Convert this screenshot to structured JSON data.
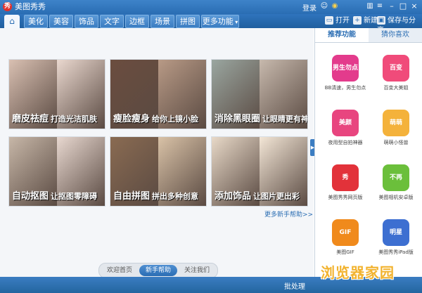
{
  "app": {
    "title": "美图秀秀",
    "login": "登录"
  },
  "tabs": [
    "美化",
    "美容",
    "饰品",
    "文字",
    "边框",
    "场景",
    "拼图",
    "更多功能"
  ],
  "actions": {
    "open": "打开",
    "new": "新建",
    "save_share": "保存与分享"
  },
  "features": [
    {
      "title": "磨皮祛痘",
      "subtitle": "打造光洁肌肤",
      "colors": [
        "#d9c0b2",
        "#ead8cf"
      ]
    },
    {
      "title": "瘦脸瘦身",
      "subtitle": "给你上镜小脸",
      "colors": [
        "#6b4d3f",
        "#b89a86"
      ]
    },
    {
      "title": "消除黑眼圈",
      "subtitle": "让眼睛更有神",
      "colors": [
        "#9aa6a0",
        "#c7b9ad"
      ]
    },
    {
      "title": "自动抠图",
      "subtitle": "让抠图零障碍",
      "colors": [
        "#c7b7a8",
        "#e8d8d0"
      ]
    },
    {
      "title": "自由拼图",
      "subtitle": "拼出多种创意",
      "colors": [
        "#8a6b52",
        "#d9c2a7"
      ]
    },
    {
      "title": "添加饰品",
      "subtitle": "让图片更出彩",
      "colors": [
        "#e8d9c8",
        "#f3e6d6"
      ]
    }
  ],
  "more_help": "更多新手帮助>>",
  "bottom_tabs": [
    "欢迎首页",
    "新手帮助",
    "关注我们"
  ],
  "bottom_active": 1,
  "side_tabs": [
    "推荐功能",
    "猜你喜欢"
  ],
  "side_active": 0,
  "apps": [
    {
      "name": "BB清速，男生勿点",
      "icon_text": "男生勿点",
      "color": "#e33b8c"
    },
    {
      "name": "百变大美姐",
      "icon_text": "百变",
      "color": "#f04b7a"
    },
    {
      "name": "夜用型自拍神器",
      "icon_text": "美颜",
      "color": "#e8457f"
    },
    {
      "name": "萌萌小怪兽",
      "icon_text": "萌萌",
      "color": "#f4b23b"
    },
    {
      "name": "美图秀秀网页版",
      "icon_text": "秀",
      "color": "#e2323a"
    },
    {
      "name": "美图相机安卓版",
      "icon_text": "不再",
      "color": "#6bbf3b"
    },
    {
      "name": "美图GIF",
      "icon_text": "GIF",
      "color": "#f08a1c"
    },
    {
      "name": "美图秀秀iPad版",
      "icon_text": "明星",
      "color": "#3d6fd1"
    }
  ],
  "status": {
    "batch": "批处理"
  },
  "watermark": "浏览器家园"
}
